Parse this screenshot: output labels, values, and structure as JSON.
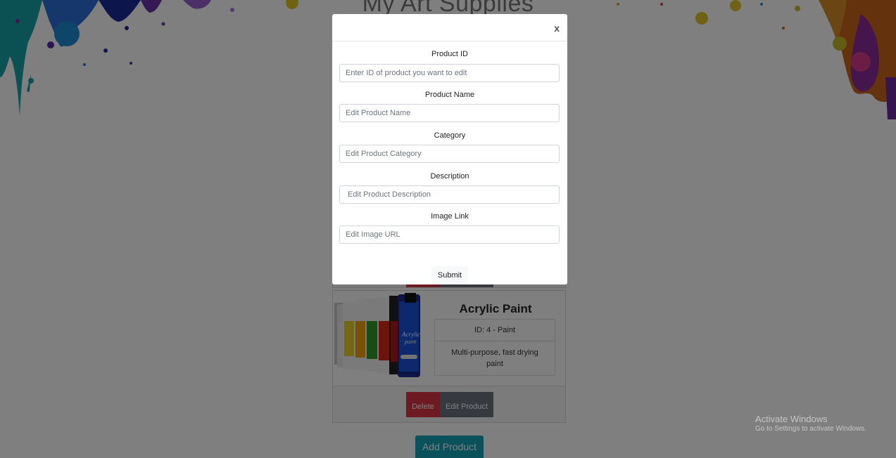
{
  "page": {
    "title": "My Art Supplies"
  },
  "product_card": {
    "name": "Acrylic Paint",
    "id_category": "ID: 4 - Paint",
    "description": "Multi-purpose, fast drying paint",
    "delete_label": "Delete",
    "edit_label": "Edit Product"
  },
  "add_product_label": "Add Product",
  "modal": {
    "close_label": "x",
    "fields": [
      {
        "label": "Product ID",
        "placeholder": "Enter ID of product you want to edit"
      },
      {
        "label": "Product Name",
        "placeholder": "Edit Product Name"
      },
      {
        "label": "Category",
        "placeholder": "Edit Product Category"
      },
      {
        "label": "Description",
        "placeholder": " Edit Product Description"
      },
      {
        "label": "Image Link",
        "placeholder": "Edit Image URL"
      }
    ],
    "submit_label": "Submit"
  },
  "watermark": {
    "title": "Activate Windows",
    "subtitle": "Go to Settings to activate Windows."
  },
  "colors": {
    "delete": "#dc3545",
    "edit": "#6c757d",
    "add": "#17a2b8"
  }
}
